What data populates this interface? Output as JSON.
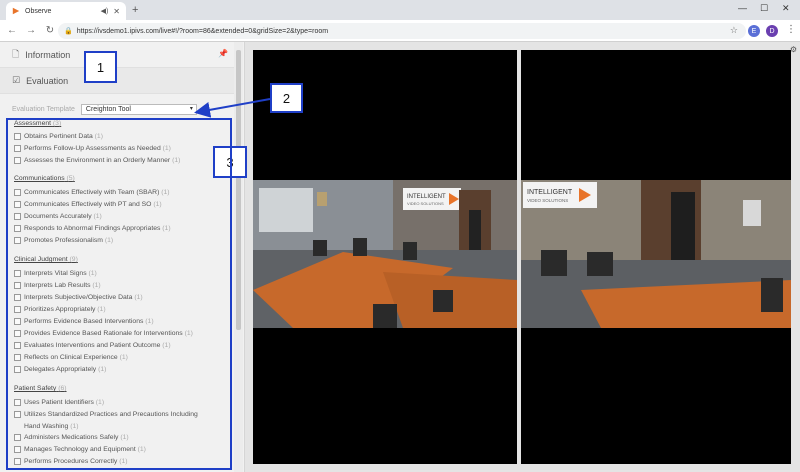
{
  "browser": {
    "tab_title": "Observe",
    "url": "https://ivsdemo1.ipivs.com/live#!/?room=86&extended=0&gridSize=2&type=room",
    "profile_initial": "D",
    "extension_initial": "E"
  },
  "panel": {
    "information_label": "Information",
    "evaluation_label": "Evaluation",
    "template_label": "Evaluation Template",
    "template_value": "Creighton Tool"
  },
  "criteria": {
    "categories": [
      {
        "label": "Assessment",
        "count": "(3)",
        "items": [
          {
            "label": "Obtains Pertinent Data",
            "count": "(1)"
          },
          {
            "label": "Performs Follow-Up Assessments as Needed",
            "count": "(1)"
          },
          {
            "label": "Assesses the Environment in an Orderly Manner",
            "count": "(1)"
          }
        ]
      },
      {
        "label": "Communications",
        "count": "(5)",
        "items": [
          {
            "label": "Communicates Effectively with Team (SBAR)",
            "count": "(1)"
          },
          {
            "label": "Communicates Effectively with PT and SO",
            "count": "(1)"
          },
          {
            "label": "Documents Accurately",
            "count": "(1)"
          },
          {
            "label": "Responds to Abnormal Findings Appropriates",
            "count": "(1)"
          },
          {
            "label": "Promotes Professionalism",
            "count": "(1)"
          }
        ]
      },
      {
        "label": "Clinical Judgment",
        "count": "(9)",
        "items": [
          {
            "label": "Interprets Vital Signs",
            "count": "(1)"
          },
          {
            "label": "Interprets Lab Results",
            "count": "(1)"
          },
          {
            "label": "Interprets Subjective/Objective Data",
            "count": "(1)"
          },
          {
            "label": "Prioritizes Appropriately",
            "count": "(1)"
          },
          {
            "label": "Performs Evidence Based Interventions",
            "count": "(1)"
          },
          {
            "label": "Provides Evidence Based Rationale for Interventions",
            "count": "(1)"
          },
          {
            "label": "Evaluates Interventions and Patient Outcome",
            "count": "(1)"
          },
          {
            "label": "Reflects on Clinical Experience",
            "count": "(1)"
          },
          {
            "label": "Delegates Appropriately",
            "count": "(1)"
          }
        ]
      },
      {
        "label": "Patient Safety",
        "count": "(6)",
        "items": [
          {
            "label": "Uses Patient Identifiers",
            "count": "(1)"
          },
          {
            "label": "Utilizes Standardized Practices and Precautions Including Hand Washing",
            "count": "(1)"
          },
          {
            "label": "Administers Medications Safely",
            "count": "(1)"
          },
          {
            "label": "Manages Technology and Equipment",
            "count": "(1)"
          },
          {
            "label": "Performs Procedures Correctly",
            "count": "(1)"
          }
        ]
      }
    ]
  },
  "annotations": {
    "one": "1",
    "two": "2",
    "three": "3"
  },
  "video": {
    "sign_line1": "INTELLIGENT",
    "sign_line2": "VIDEO SOLUTIONS"
  },
  "colors": {
    "annotation_blue": "#1f3fc7",
    "accent_orange": "#e8742a"
  }
}
